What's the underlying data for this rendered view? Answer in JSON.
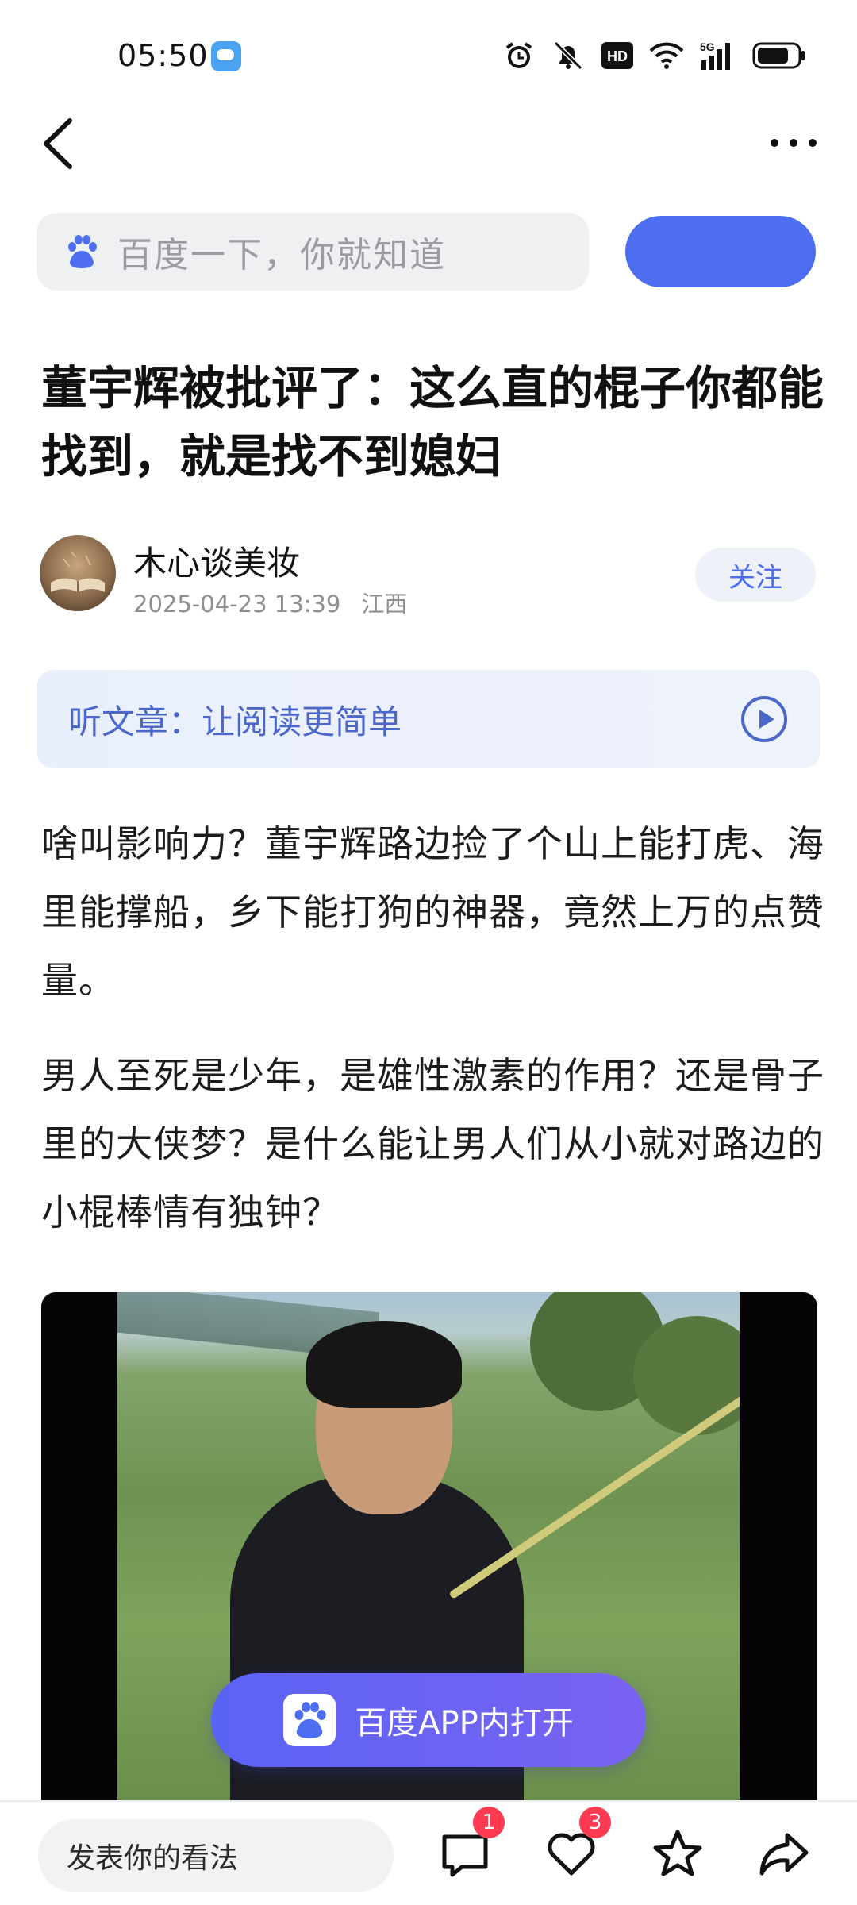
{
  "status_bar": {
    "time": "05:50",
    "network": "5G",
    "hd": "HD"
  },
  "search": {
    "placeholder": "百度一下，你就知道"
  },
  "article": {
    "title": "董宇辉被批评了：这么直的棍子你都能找到，就是找不到媳妇",
    "author": {
      "name": "木心谈美妆",
      "date": "2025-04-23 13:39",
      "location": "江西",
      "follow_label": "关注"
    },
    "listen_label": "听文章：让阅读更简单",
    "paragraphs": [
      "啥叫影响力？董宇辉路边捡了个山上能打虎、海里能撑船，乡下能打狗的神器，竟然上万的点赞量。",
      "男人至死是少年，是雄性激素的作用？还是骨子里的大侠梦？是什么能让男人们从小就对路边的小棍棒情有独钟？"
    ],
    "open_app_label": "百度APP内打开"
  },
  "bottom_bar": {
    "comment_placeholder": "发表你的看法",
    "comment_count": "1",
    "like_count": "3"
  },
  "colors": {
    "accent": "#4e6ef2",
    "badge": "#ff3b54"
  }
}
